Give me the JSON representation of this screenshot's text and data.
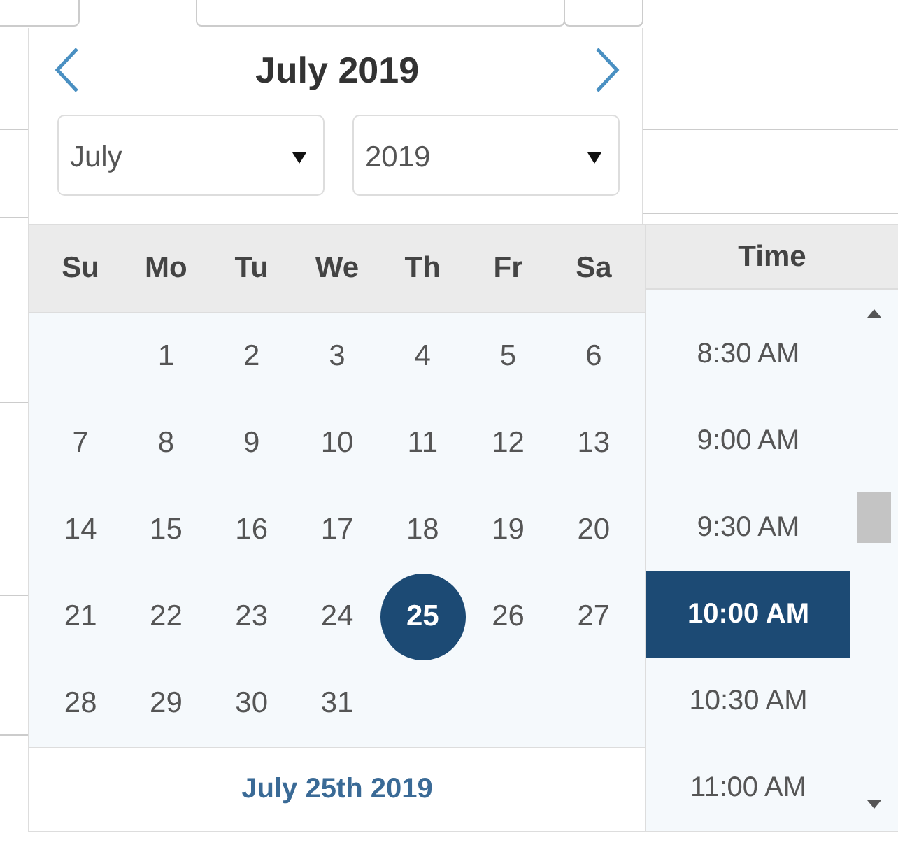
{
  "title": "July 2019",
  "month_select": {
    "value": "July"
  },
  "year_select": {
    "value": "2019"
  },
  "weekdays": [
    "Su",
    "Mo",
    "Tu",
    "We",
    "Th",
    "Fr",
    "Sa"
  ],
  "weeks": [
    [
      {
        "kind": "blank"
      },
      {
        "kind": "day",
        "label": "1",
        "selected": false
      },
      {
        "kind": "day",
        "label": "2",
        "selected": false
      },
      {
        "kind": "day",
        "label": "3",
        "selected": false
      },
      {
        "kind": "day",
        "label": "4",
        "selected": false
      },
      {
        "kind": "day",
        "label": "5",
        "selected": false
      },
      {
        "kind": "day",
        "label": "6",
        "selected": false
      }
    ],
    [
      {
        "kind": "day",
        "label": "7",
        "selected": false
      },
      {
        "kind": "day",
        "label": "8",
        "selected": false
      },
      {
        "kind": "day",
        "label": "9",
        "selected": false
      },
      {
        "kind": "day",
        "label": "10",
        "selected": false
      },
      {
        "kind": "day",
        "label": "11",
        "selected": false
      },
      {
        "kind": "day",
        "label": "12",
        "selected": false
      },
      {
        "kind": "day",
        "label": "13",
        "selected": false
      }
    ],
    [
      {
        "kind": "day",
        "label": "14",
        "selected": false
      },
      {
        "kind": "day",
        "label": "15",
        "selected": false
      },
      {
        "kind": "day",
        "label": "16",
        "selected": false
      },
      {
        "kind": "day",
        "label": "17",
        "selected": false
      },
      {
        "kind": "day",
        "label": "18",
        "selected": false
      },
      {
        "kind": "day",
        "label": "19",
        "selected": false
      },
      {
        "kind": "day",
        "label": "20",
        "selected": false
      }
    ],
    [
      {
        "kind": "day",
        "label": "21",
        "selected": false
      },
      {
        "kind": "day",
        "label": "22",
        "selected": false
      },
      {
        "kind": "day",
        "label": "23",
        "selected": false
      },
      {
        "kind": "day",
        "label": "24",
        "selected": false
      },
      {
        "kind": "day",
        "label": "25",
        "selected": true
      },
      {
        "kind": "day",
        "label": "26",
        "selected": false
      },
      {
        "kind": "day",
        "label": "27",
        "selected": false
      }
    ],
    [
      {
        "kind": "day",
        "label": "28",
        "selected": false
      },
      {
        "kind": "day",
        "label": "29",
        "selected": false
      },
      {
        "kind": "day",
        "label": "30",
        "selected": false
      },
      {
        "kind": "day",
        "label": "31",
        "selected": false
      }
    ]
  ],
  "footer": "July 25th 2019",
  "time_header": "Time",
  "times": [
    {
      "label": "8:30 AM",
      "selected": false
    },
    {
      "label": "9:00 AM",
      "selected": false
    },
    {
      "label": "9:30 AM",
      "selected": false
    },
    {
      "label": "10:00 AM",
      "selected": true
    },
    {
      "label": "10:30 AM",
      "selected": false
    },
    {
      "label": "11:00 AM",
      "selected": false
    }
  ]
}
